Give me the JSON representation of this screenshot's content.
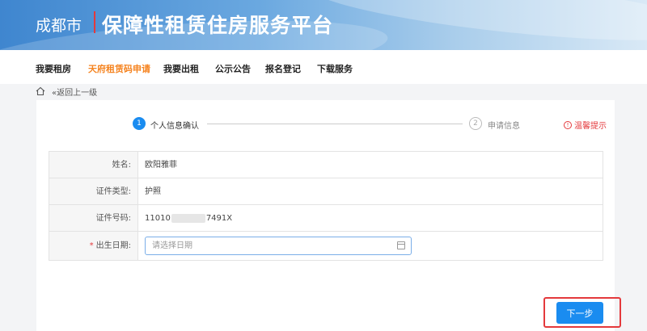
{
  "header": {
    "city": "成都市",
    "platform_title": "保障性租赁住房服务平台"
  },
  "nav": {
    "items": [
      {
        "label": "我要租房"
      },
      {
        "label": "天府租赁码申请",
        "active": true
      },
      {
        "label": "我要出租"
      },
      {
        "label": "公示公告"
      },
      {
        "label": "报名登记"
      },
      {
        "label": "下载服务"
      }
    ]
  },
  "breadcrumb": {
    "back_label": "«返回上一级"
  },
  "steps": [
    {
      "number": "1",
      "label": "个人信息确认",
      "active": true
    },
    {
      "number": "2",
      "label": "申请信息",
      "active": false
    }
  ],
  "tip_label": "温馨提示",
  "form": {
    "name_label": "姓名:",
    "name_value": "欧阳雅菲",
    "id_type_label": "证件类型:",
    "id_type_value": "护照",
    "id_number_label": "证件号码:",
    "id_number_prefix": "11010",
    "id_number_suffix": "7491X",
    "birth_label": "出生日期:",
    "birth_required_mark": "*",
    "birth_placeholder": "请选择日期"
  },
  "next_button_label": "下一步",
  "colors": {
    "accent": "#1a8cf0",
    "nav_active": "#f5831f",
    "highlight": "#e4393c"
  }
}
